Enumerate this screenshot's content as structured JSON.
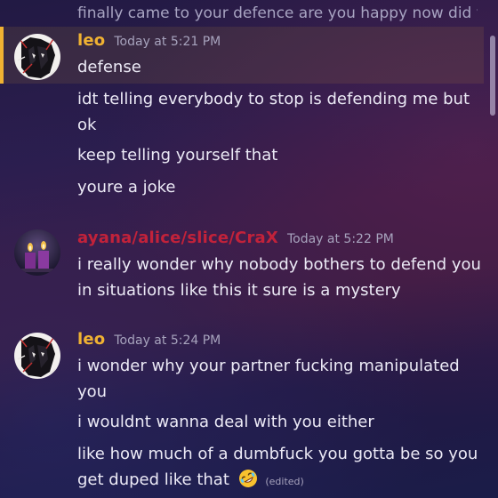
{
  "colors": {
    "leo_name": "#f0b232",
    "ayana_name": "#c2223a",
    "highlight_bar": "#f0b232",
    "text": "#eceaf6",
    "muted": "#a7a3bd"
  },
  "previous_message": {
    "text": "finally came to your defence are you happy now did yo…"
  },
  "groups": [
    {
      "username": "leo",
      "timestamp": "Today at 5:21 PM",
      "avatar": "dark-manga-avatar",
      "messages": [
        {
          "text": "defense"
        },
        {
          "text": "idt telling everybody to stop is defending me but ok"
        },
        {
          "text": "keep telling yourself that"
        },
        {
          "text": "youre a joke"
        }
      ]
    },
    {
      "username": "ayana/alice/slice/CraX",
      "timestamp": "Today at 5:22 PM",
      "avatar": "candles-avatar",
      "messages": [
        {
          "text": "i really wonder why nobody bothers to defend you in situations like this it sure is a mystery"
        }
      ]
    },
    {
      "username": "leo",
      "timestamp": "Today at 5:24 PM",
      "avatar": "dark-manga-avatar",
      "messages": [
        {
          "text": "i wonder why your partner fucking manipulated you"
        },
        {
          "text": "i wouldnt wanna deal with you either"
        },
        {
          "text": "like how much of a dumbfuck you gotta be so you get duped like that",
          "emoji": "rofl-emoji",
          "edited_label": "(edited)"
        }
      ]
    }
  ]
}
